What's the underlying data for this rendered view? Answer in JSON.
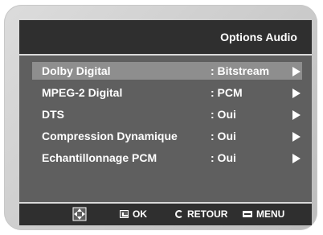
{
  "header": {
    "title": "Options Audio"
  },
  "menu": {
    "rows": [
      {
        "label": "Dolby Digital",
        "value": ": Bitstream",
        "selected": true
      },
      {
        "label": "MPEG-2 Digital",
        "value": ": PCM",
        "selected": false
      },
      {
        "label": "DTS",
        "value": ": Oui",
        "selected": false
      },
      {
        "label": "Compression Dynamique",
        "value": ": Oui",
        "selected": false
      },
      {
        "label": "Echantillonnage PCM",
        "value": ": Oui",
        "selected": false
      }
    ]
  },
  "footer": {
    "nav_icon": "dpad-icon",
    "ok_label": "OK",
    "ok_icon": "enter-icon",
    "return_label": "RETOUR",
    "return_icon": "return-icon",
    "menu_label": "MENU",
    "menu_icon": "menu-icon"
  },
  "colors": {
    "panel": "#5f5f5f",
    "bar": "#2f2f2f",
    "selected_row": "#8e8e8e",
    "text": "#ffffff"
  }
}
